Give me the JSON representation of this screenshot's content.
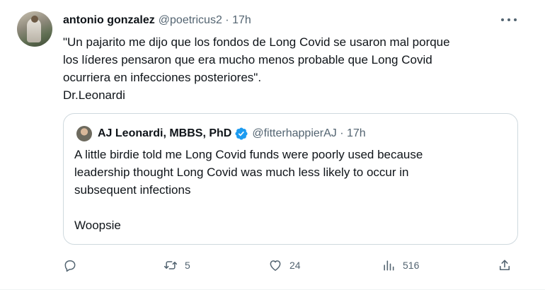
{
  "tweet": {
    "author_name": "antonio gonzalez",
    "author_handle_time": "@poetricus2 · 17h",
    "text": "\"Un pajarito me dijo que los fondos de Long Covid se usaron mal porque\nlos líderes pensaron que era mucho menos probable que Long Covid\nocurriera en infecciones posteriores\".\nDr.Leonardi"
  },
  "quoted": {
    "author_name": "AJ Leonardi, MBBS, PhD",
    "author_handle_time": "@fitterhappierAJ · 17h",
    "text": "A little birdie told me Long Covid funds were poorly used because\nleadership thought Long Covid was much less likely to occur in\nsubsequent infections\n\nWoopsie",
    "verified_color": "#1d9bf0"
  },
  "actions": {
    "reply_count": "",
    "retweet_count": "5",
    "like_count": "24",
    "views_count": "516"
  },
  "icons": [
    "more-icon",
    "verified-icon",
    "reply-icon",
    "retweet-icon",
    "like-icon",
    "views-icon",
    "share-icon"
  ]
}
